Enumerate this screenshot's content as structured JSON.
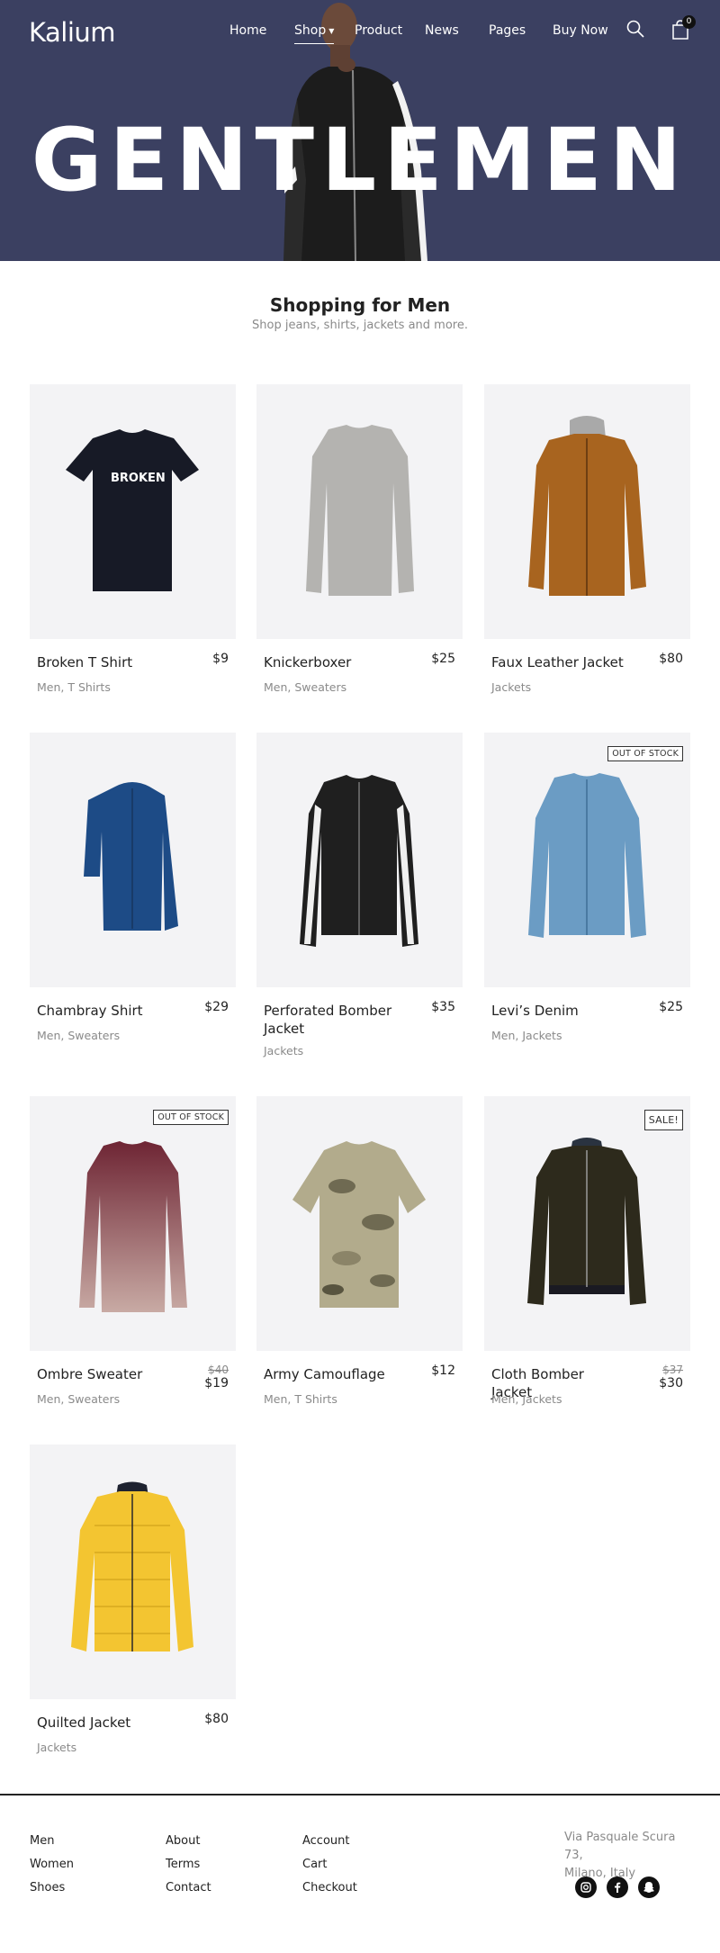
{
  "brand": {
    "logo": "Kalium"
  },
  "nav": {
    "items": [
      {
        "label": "Home"
      },
      {
        "label": "Shop"
      },
      {
        "label": "Product"
      },
      {
        "label": "News"
      },
      {
        "label": "Pages"
      },
      {
        "label": "Buy Now"
      }
    ],
    "cart_count": "0",
    "search_icon": "search-icon",
    "cart_icon": "shopping-bag-icon"
  },
  "hero": {
    "title": "GENTLEMEN"
  },
  "section": {
    "title": "Shopping for Men",
    "subtitle": "Shop jeans, shirts, jackets and more."
  },
  "products": [
    {
      "name": "Broken T Shirt",
      "category": "Men, T Shirts",
      "price": "$9",
      "image_text": "BROKEN"
    },
    {
      "name": "Knickerboxer",
      "category": "Men, Sweaters",
      "price": "$25"
    },
    {
      "name": "Faux Leather Jacket",
      "category": "Jackets",
      "price": "$80"
    },
    {
      "name": "Chambray Shirt",
      "category": "Men, Sweaters",
      "price": "$29"
    },
    {
      "name": "Perforated Bomber Jacket",
      "category": "Jackets",
      "price": "$35"
    },
    {
      "name": "Levi’s Denim",
      "category": "Men, Jackets",
      "price": "$25",
      "badge": "OUT OF STOCK"
    },
    {
      "name": "Ombre Sweater",
      "category": "Men, Sweaters",
      "price": "$19",
      "old_price": "$40",
      "badge": "OUT OF STOCK"
    },
    {
      "name": "Army Camouflage",
      "category": "Men, T Shirts",
      "price": "$12"
    },
    {
      "name": "Cloth Bomber Jacket",
      "category": "Men, Jackets",
      "price": "$30",
      "old_price": "$37",
      "badge": "SALE!"
    },
    {
      "name": "Quilted Jacket",
      "category": "Jackets",
      "price": "$80"
    }
  ],
  "footer": {
    "col1": [
      "Men",
      "Women",
      "Shoes"
    ],
    "col2": [
      "About",
      "Terms",
      "Contact"
    ],
    "col3": [
      "Account",
      "Cart",
      "Checkout"
    ],
    "address_line1": "Via Pasquale Scura 73,",
    "address_line2": "Milano, Italy",
    "social_icons": [
      "instagram-icon",
      "facebook-icon",
      "snapchat-icon"
    ]
  },
  "colors": {
    "hero_bg": "#3b4061",
    "card_bg": "#f3f3f5",
    "muted_text": "#8a8a8a"
  }
}
